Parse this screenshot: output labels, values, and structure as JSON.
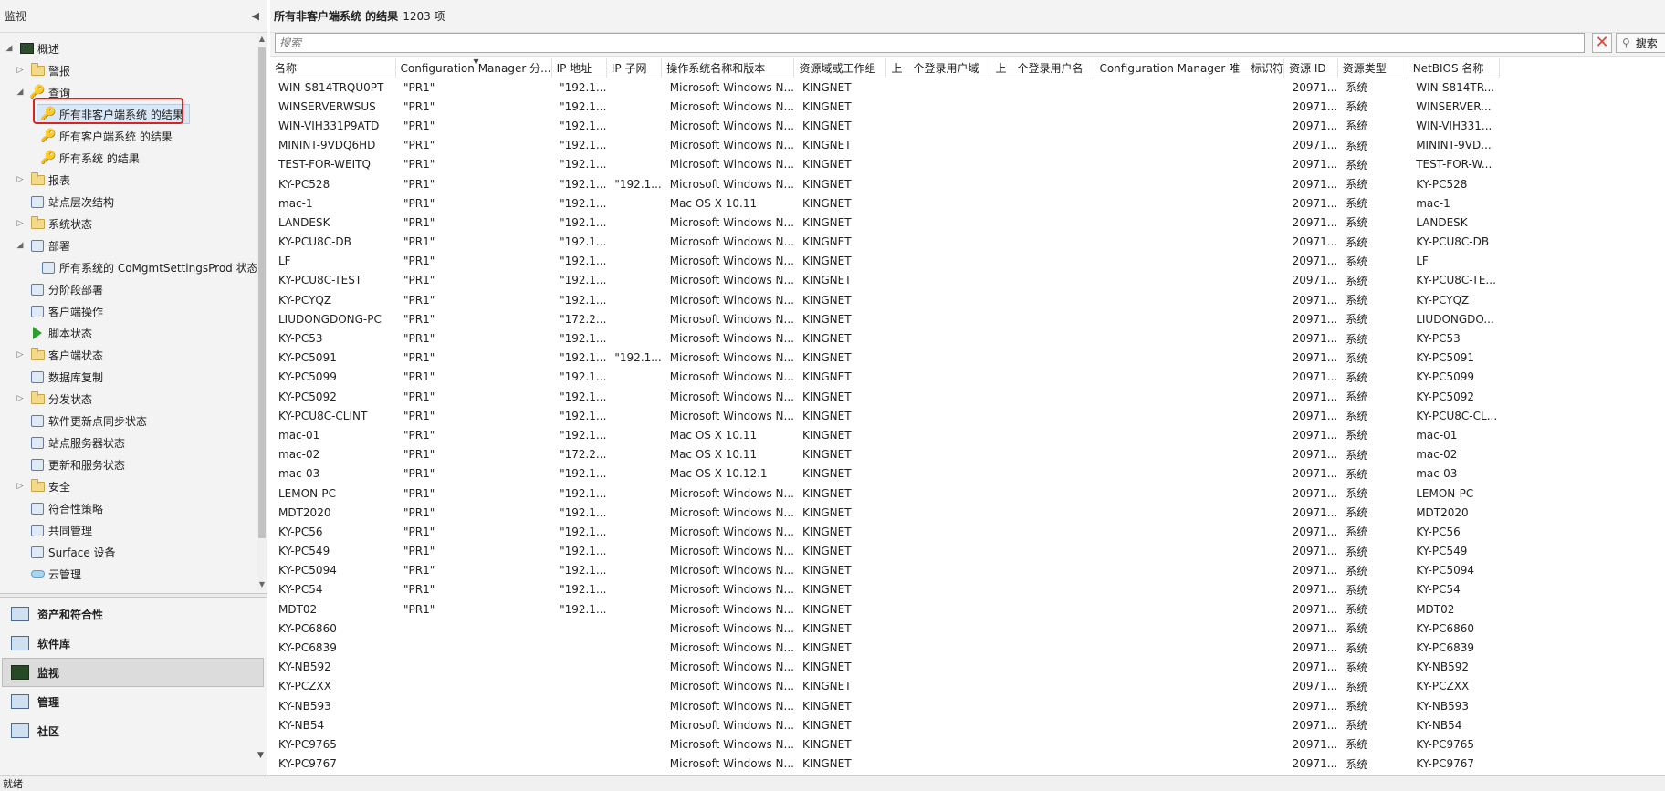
{
  "nav": {
    "title": "监视",
    "tree": [
      {
        "label": "概述",
        "level": 0,
        "expander": "◢",
        "icon": "monitor"
      },
      {
        "label": "警报",
        "level": 1,
        "expander": "▷",
        "icon": "folder"
      },
      {
        "label": "查询",
        "level": 1,
        "expander": "◢",
        "icon": "query"
      },
      {
        "label": "所有非客户端系统 的结果",
        "level": 2,
        "expander": "",
        "icon": "query",
        "selected": true
      },
      {
        "label": "所有客户端系统 的结果",
        "level": 2,
        "expander": "",
        "icon": "query"
      },
      {
        "label": "所有系统 的结果",
        "level": 2,
        "expander": "",
        "icon": "query"
      },
      {
        "label": "报表",
        "level": 1,
        "expander": "▷",
        "icon": "folder"
      },
      {
        "label": "站点层次结构",
        "level": 1,
        "expander": "",
        "icon": "generic"
      },
      {
        "label": "系统状态",
        "level": 1,
        "expander": "▷",
        "icon": "folder"
      },
      {
        "label": "部署",
        "level": 1,
        "expander": "◢",
        "icon": "generic"
      },
      {
        "label": "所有系统的 CoMgmtSettingsProd 状态",
        "level": 2,
        "expander": "",
        "icon": "generic"
      },
      {
        "label": "分阶段部署",
        "level": 1,
        "expander": "",
        "icon": "generic"
      },
      {
        "label": "客户端操作",
        "level": 1,
        "expander": "",
        "icon": "generic"
      },
      {
        "label": "脚本状态",
        "level": 1,
        "expander": "",
        "icon": "green"
      },
      {
        "label": "客户端状态",
        "level": 1,
        "expander": "▷",
        "icon": "folder"
      },
      {
        "label": "数据库复制",
        "level": 1,
        "expander": "",
        "icon": "generic"
      },
      {
        "label": "分发状态",
        "level": 1,
        "expander": "▷",
        "icon": "folder"
      },
      {
        "label": "软件更新点同步状态",
        "level": 1,
        "expander": "",
        "icon": "generic"
      },
      {
        "label": "站点服务器状态",
        "level": 1,
        "expander": "",
        "icon": "generic"
      },
      {
        "label": "更新和服务状态",
        "level": 1,
        "expander": "",
        "icon": "generic"
      },
      {
        "label": "安全",
        "level": 1,
        "expander": "▷",
        "icon": "folder"
      },
      {
        "label": "符合性策略",
        "level": 1,
        "expander": "",
        "icon": "generic"
      },
      {
        "label": "共同管理",
        "level": 1,
        "expander": "",
        "icon": "generic"
      },
      {
        "label": "Surface 设备",
        "level": 1,
        "expander": "",
        "icon": "generic"
      },
      {
        "label": "云管理",
        "level": 1,
        "expander": "",
        "icon": "cloud"
      }
    ],
    "wunderbar": [
      {
        "label": "资产和符合性",
        "active": false,
        "dark": false
      },
      {
        "label": "软件库",
        "active": false,
        "dark": false
      },
      {
        "label": "监视",
        "active": true,
        "dark": true
      },
      {
        "label": "管理",
        "active": false,
        "dark": false
      },
      {
        "label": "社区",
        "active": false,
        "dark": false
      }
    ]
  },
  "results": {
    "title": "所有非客户端系统 的结果",
    "count": "1203 项",
    "search_placeholder": "搜索",
    "search_button": "搜索",
    "columns": [
      "名称",
      "Configuration Manager 分...",
      "IP 地址",
      "IP 子网",
      "操作系统名称和版本",
      "资源域或工作组",
      "上一个登录用户域",
      "上一个登录用户名",
      "Configuration Manager 唯一标识符",
      "资源 ID",
      "资源类型",
      "NetBIOS 名称"
    ],
    "rows": [
      [
        "WIN-S814TRQU0PT",
        "\"PR1\"",
        "\"192.1...",
        "",
        "Microsoft Windows N...",
        "KINGNET",
        "",
        "",
        "",
        "20971...",
        "系统",
        "WIN-S814TR..."
      ],
      [
        "WINSERVERWSUS",
        "\"PR1\"",
        "\"192.1...",
        "",
        "Microsoft Windows N...",
        "KINGNET",
        "",
        "",
        "",
        "20971...",
        "系统",
        "WINSERVER..."
      ],
      [
        "WIN-VIH331P9ATD",
        "\"PR1\"",
        "\"192.1...",
        "",
        "Microsoft Windows N...",
        "KINGNET",
        "",
        "",
        "",
        "20971...",
        "系统",
        "WIN-VIH331..."
      ],
      [
        "MININT-9VDQ6HD",
        "\"PR1\"",
        "\"192.1...",
        "",
        "Microsoft Windows N...",
        "KINGNET",
        "",
        "",
        "",
        "20971...",
        "系统",
        "MININT-9VD..."
      ],
      [
        "TEST-FOR-WEITQ",
        "\"PR1\"",
        "\"192.1...",
        "",
        "Microsoft Windows N...",
        "KINGNET",
        "",
        "",
        "",
        "20971...",
        "系统",
        "TEST-FOR-W..."
      ],
      [
        "KY-PC528",
        "\"PR1\"",
        "\"192.1...",
        "\"192.1...",
        "Microsoft Windows N...",
        "KINGNET",
        "",
        "",
        "",
        "20971...",
        "系统",
        "KY-PC528"
      ],
      [
        "mac-1",
        "\"PR1\"",
        "\"192.1...",
        "",
        "Mac OS X 10.11",
        "KINGNET",
        "",
        "",
        "",
        "20971...",
        "系统",
        "mac-1"
      ],
      [
        "LANDESK",
        "\"PR1\"",
        "\"192.1...",
        "",
        "Microsoft Windows N...",
        "KINGNET",
        "",
        "",
        "",
        "20971...",
        "系统",
        "LANDESK"
      ],
      [
        "KY-PCU8C-DB",
        "\"PR1\"",
        "\"192.1...",
        "",
        "Microsoft Windows N...",
        "KINGNET",
        "",
        "",
        "",
        "20971...",
        "系统",
        "KY-PCU8C-DB"
      ],
      [
        "LF",
        "\"PR1\"",
        "\"192.1...",
        "",
        "Microsoft Windows N...",
        "KINGNET",
        "",
        "",
        "",
        "20971...",
        "系统",
        "LF"
      ],
      [
        "KY-PCU8C-TEST",
        "\"PR1\"",
        "\"192.1...",
        "",
        "Microsoft Windows N...",
        "KINGNET",
        "",
        "",
        "",
        "20971...",
        "系统",
        "KY-PCU8C-TE..."
      ],
      [
        "KY-PCYQZ",
        "\"PR1\"",
        "\"192.1...",
        "",
        "Microsoft Windows N...",
        "KINGNET",
        "",
        "",
        "",
        "20971...",
        "系统",
        "KY-PCYQZ"
      ],
      [
        "LIUDONGDONG-PC",
        "\"PR1\"",
        "\"172.2...",
        "",
        "Microsoft Windows N...",
        "KINGNET",
        "",
        "",
        "",
        "20971...",
        "系统",
        "LIUDONGDO..."
      ],
      [
        "KY-PC53",
        "\"PR1\"",
        "\"192.1...",
        "",
        "Microsoft Windows N...",
        "KINGNET",
        "",
        "",
        "",
        "20971...",
        "系统",
        "KY-PC53"
      ],
      [
        "KY-PC5091",
        "\"PR1\"",
        "\"192.1...",
        "\"192.1...",
        "Microsoft Windows N...",
        "KINGNET",
        "",
        "",
        "",
        "20971...",
        "系统",
        "KY-PC5091"
      ],
      [
        "KY-PC5099",
        "\"PR1\"",
        "\"192.1...",
        "",
        "Microsoft Windows N...",
        "KINGNET",
        "",
        "",
        "",
        "20971...",
        "系统",
        "KY-PC5099"
      ],
      [
        "KY-PC5092",
        "\"PR1\"",
        "\"192.1...",
        "",
        "Microsoft Windows N...",
        "KINGNET",
        "",
        "",
        "",
        "20971...",
        "系统",
        "KY-PC5092"
      ],
      [
        "KY-PCU8C-CLINT",
        "\"PR1\"",
        "\"192.1...",
        "",
        "Microsoft Windows N...",
        "KINGNET",
        "",
        "",
        "",
        "20971...",
        "系统",
        "KY-PCU8C-CL..."
      ],
      [
        "mac-01",
        "\"PR1\"",
        "\"192.1...",
        "",
        "Mac OS X 10.11",
        "KINGNET",
        "",
        "",
        "",
        "20971...",
        "系统",
        "mac-01"
      ],
      [
        "mac-02",
        "\"PR1\"",
        "\"172.2...",
        "",
        "Mac OS X 10.11",
        "KINGNET",
        "",
        "",
        "",
        "20971...",
        "系统",
        "mac-02"
      ],
      [
        "mac-03",
        "\"PR1\"",
        "\"192.1...",
        "",
        "Mac OS X 10.12.1",
        "KINGNET",
        "",
        "",
        "",
        "20971...",
        "系统",
        "mac-03"
      ],
      [
        "LEMON-PC",
        "\"PR1\"",
        "\"192.1...",
        "",
        "Microsoft Windows N...",
        "KINGNET",
        "",
        "",
        "",
        "20971...",
        "系统",
        "LEMON-PC"
      ],
      [
        "MDT2020",
        "\"PR1\"",
        "\"192.1...",
        "",
        "Microsoft Windows N...",
        "KINGNET",
        "",
        "",
        "",
        "20971...",
        "系统",
        "MDT2020"
      ],
      [
        "KY-PC56",
        "\"PR1\"",
        "\"192.1...",
        "",
        "Microsoft Windows N...",
        "KINGNET",
        "",
        "",
        "",
        "20971...",
        "系统",
        "KY-PC56"
      ],
      [
        "KY-PC549",
        "\"PR1\"",
        "\"192.1...",
        "",
        "Microsoft Windows N...",
        "KINGNET",
        "",
        "",
        "",
        "20971...",
        "系统",
        "KY-PC549"
      ],
      [
        "KY-PC5094",
        "\"PR1\"",
        "\"192.1...",
        "",
        "Microsoft Windows N...",
        "KINGNET",
        "",
        "",
        "",
        "20971...",
        "系统",
        "KY-PC5094"
      ],
      [
        "KY-PC54",
        "\"PR1\"",
        "\"192.1...",
        "",
        "Microsoft Windows N...",
        "KINGNET",
        "",
        "",
        "",
        "20971...",
        "系统",
        "KY-PC54"
      ],
      [
        "MDT02",
        "\"PR1\"",
        "\"192.1...",
        "",
        "Microsoft Windows N...",
        "KINGNET",
        "",
        "",
        "",
        "20971...",
        "系统",
        "MDT02"
      ],
      [
        "KY-PC6860",
        "",
        "",
        "",
        "Microsoft Windows N...",
        "KINGNET",
        "",
        "",
        "",
        "20971...",
        "系统",
        "KY-PC6860"
      ],
      [
        "KY-PC6839",
        "",
        "",
        "",
        "Microsoft Windows N...",
        "KINGNET",
        "",
        "",
        "",
        "20971...",
        "系统",
        "KY-PC6839"
      ],
      [
        "KY-NB592",
        "",
        "",
        "",
        "Microsoft Windows N...",
        "KINGNET",
        "",
        "",
        "",
        "20971...",
        "系统",
        "KY-NB592"
      ],
      [
        "KY-PCZXX",
        "",
        "",
        "",
        "Microsoft Windows N...",
        "KINGNET",
        "",
        "",
        "",
        "20971...",
        "系统",
        "KY-PCZXX"
      ],
      [
        "KY-NB593",
        "",
        "",
        "",
        "Microsoft Windows N...",
        "KINGNET",
        "",
        "",
        "",
        "20971...",
        "系统",
        "KY-NB593"
      ],
      [
        "KY-NB54",
        "",
        "",
        "",
        "Microsoft Windows N...",
        "KINGNET",
        "",
        "",
        "",
        "20971...",
        "系统",
        "KY-NB54"
      ],
      [
        "KY-PC9765",
        "",
        "",
        "",
        "Microsoft Windows N...",
        "KINGNET",
        "",
        "",
        "",
        "20971...",
        "系统",
        "KY-PC9765"
      ],
      [
        "KY-PC9767",
        "",
        "",
        "",
        "Microsoft Windows N...",
        "KINGNET",
        "",
        "",
        "",
        "20971...",
        "系统",
        "KY-PC9767"
      ]
    ]
  },
  "status": {
    "text": "就绪"
  }
}
